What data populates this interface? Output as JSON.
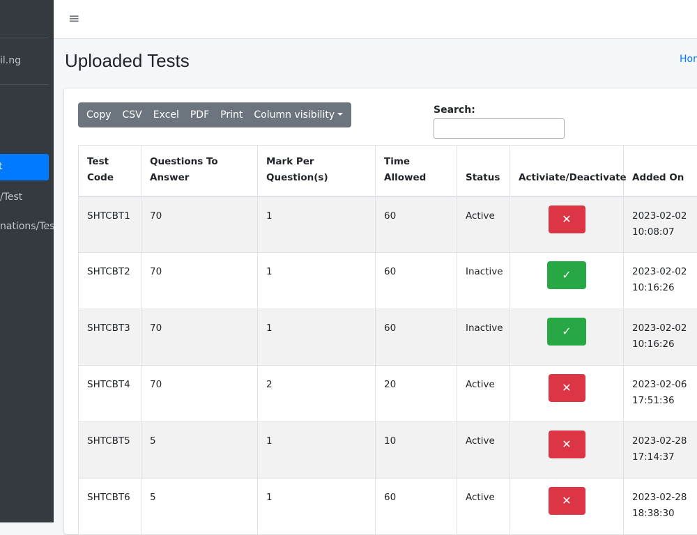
{
  "sidebar": {
    "user_label": "il.ng",
    "active_item": "t",
    "items": [
      "/Test",
      "nations/Tes"
    ]
  },
  "navbar": {
    "hamburger": "≡"
  },
  "header": {
    "title": "Uploaded Tests",
    "breadcrumb_home": "Hor"
  },
  "toolbar": {
    "buttons": [
      "Copy",
      "CSV",
      "Excel",
      "PDF",
      "Print",
      "Column visibility"
    ]
  },
  "search": {
    "label": "Search:",
    "value": ""
  },
  "table": {
    "columns": [
      "Test Code",
      "Questions To Answer",
      "Mark Per Question(s)",
      "Time Allowed",
      "Status",
      "Activiate/Deactivate",
      "Added On"
    ],
    "rows": [
      {
        "code": "SHTCBT1",
        "questions": "70",
        "mark": "1",
        "time": "60",
        "status": "Active",
        "action": "deactivate",
        "added_date": "2023-02-02",
        "added_time": "10:08:07"
      },
      {
        "code": "SHTCBT2",
        "questions": "70",
        "mark": "1",
        "time": "60",
        "status": "Inactive",
        "action": "activate",
        "added_date": "2023-02-02",
        "added_time": "10:16:26"
      },
      {
        "code": "SHTCBT3",
        "questions": "70",
        "mark": "1",
        "time": "60",
        "status": "Inactive",
        "action": "activate",
        "added_date": "2023-02-02",
        "added_time": "10:16:26"
      },
      {
        "code": "SHTCBT4",
        "questions": "70",
        "mark": "2",
        "time": "20",
        "status": "Active",
        "action": "deactivate",
        "added_date": "2023-02-06",
        "added_time": "17:51:36"
      },
      {
        "code": "SHTCBT5",
        "questions": "5",
        "mark": "1",
        "time": "10",
        "status": "Active",
        "action": "deactivate",
        "added_date": "2023-02-28",
        "added_time": "17:14:37"
      },
      {
        "code": "SHTCBT6",
        "questions": "5",
        "mark": "1",
        "time": "60",
        "status": "Active",
        "action": "deactivate",
        "added_date": "2023-02-28",
        "added_time": "18:38:30"
      }
    ]
  },
  "icons": {
    "deactivate": "times-icon",
    "activate": "check-icon"
  },
  "colors": {
    "sidebar_bg": "#343a40",
    "accent": "#007bff",
    "danger": "#dc3545",
    "success": "#28a745",
    "toolbar": "#6c757d"
  }
}
